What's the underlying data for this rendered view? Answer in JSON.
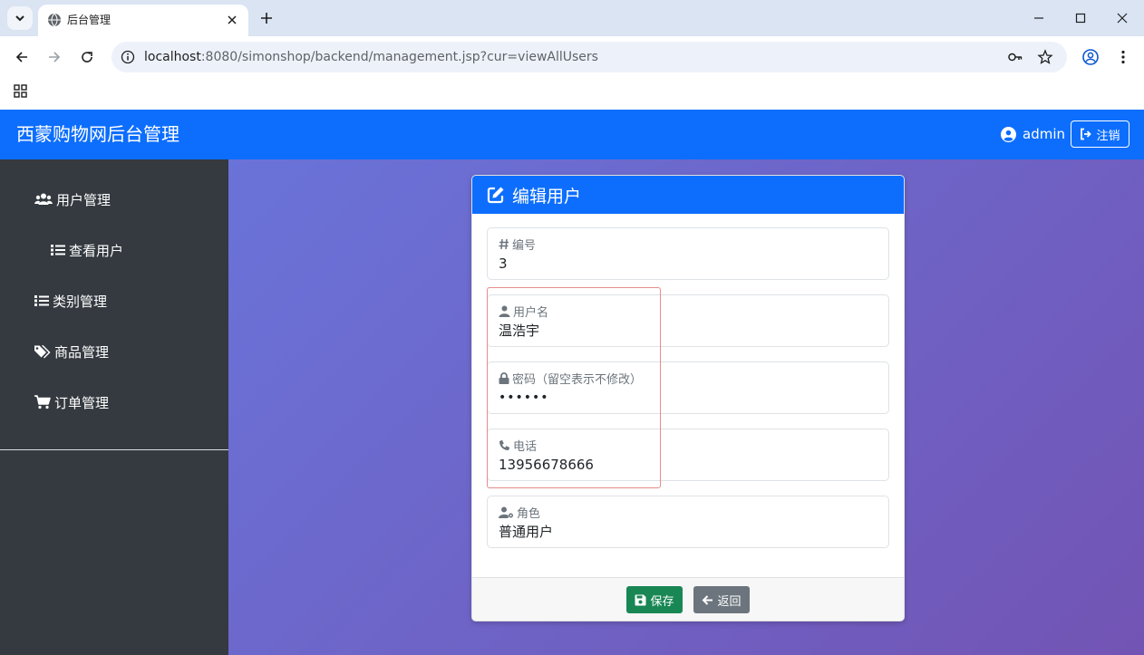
{
  "browser": {
    "tab_title": "后台管理",
    "url_host": "localhost",
    "url_rest": ":8080/simonshop/backend/management.jsp?cur=viewAllUsers"
  },
  "header": {
    "title": "西蒙购物网后台管理",
    "username": "admin",
    "logout_label": "注销"
  },
  "sidebar": {
    "items": [
      {
        "label": "用户管理",
        "icon": "users-icon"
      },
      {
        "label": "查看用户",
        "icon": "list-icon"
      },
      {
        "label": "类别管理",
        "icon": "list-icon"
      },
      {
        "label": "商品管理",
        "icon": "tags-icon"
      },
      {
        "label": "订单管理",
        "icon": "cart-icon"
      }
    ]
  },
  "card": {
    "title": "编辑用户",
    "fields": {
      "id": {
        "label": "编号",
        "value": "3"
      },
      "username": {
        "label": "用户名",
        "value": "温浩宇"
      },
      "password": {
        "label": "密码（留空表示不修改）",
        "value": "••••••"
      },
      "phone": {
        "label": "电话",
        "value": "13956678666"
      },
      "role": {
        "label": "角色",
        "value": "普通用户"
      }
    },
    "save_label": "保存",
    "back_label": "返回"
  },
  "colors": {
    "primary": "#0d6efd",
    "sidebar": "#343a40",
    "success": "#198754",
    "secondary": "#6c757d",
    "gradient_start": "#6a73d9",
    "gradient_end": "#7254b4",
    "highlight": "#e88b8b"
  }
}
